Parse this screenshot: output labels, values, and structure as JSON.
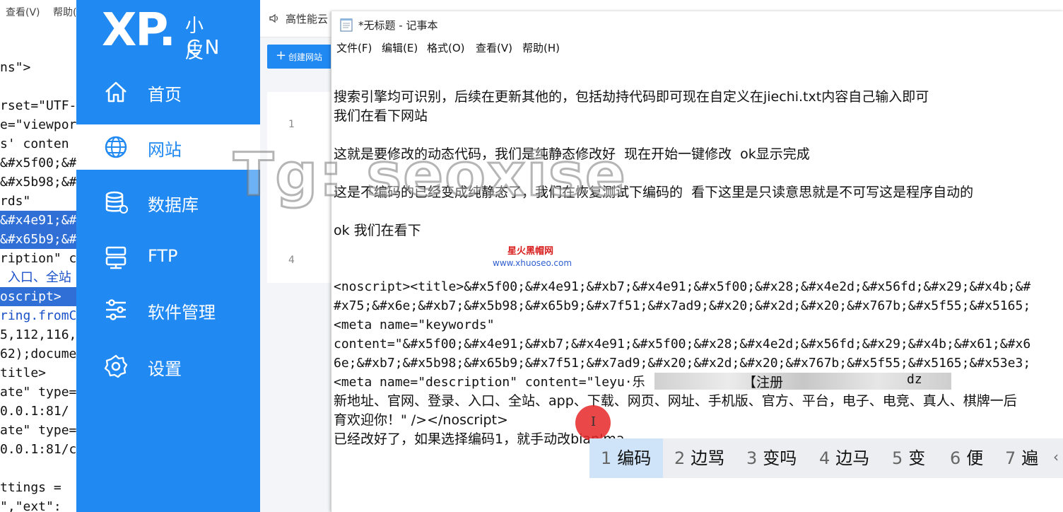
{
  "code_editor": {
    "menu": [
      "查看(V)",
      "帮助("
    ],
    "lines": [
      {
        "text": "ns\">",
        "style": ""
      },
      {
        "text": "rset=\"UTF-",
        "style": ""
      },
      {
        "text": "e=\"viewpor",
        "style": ""
      },
      {
        "text": "s' conten",
        "style": ""
      },
      {
        "text": "&#x5f00;&#",
        "style": ""
      },
      {
        "text": "&#x5b98;&#",
        "style": ""
      },
      {
        "text": "rds\"",
        "style": ""
      },
      {
        "text": "&#x4e91;&#",
        "style": "sel"
      },
      {
        "text": "&#x65b9;&#",
        "style": "sel"
      },
      {
        "text": "ription\" co",
        "style": ""
      },
      {
        "text": " 入口、全站",
        "style": "blue"
      },
      {
        "text": "oscript>",
        "style": "sel"
      },
      {
        "text": "ring.fromC",
        "style": "blue"
      },
      {
        "text": "5,112,116,",
        "style": ""
      },
      {
        "text": "62);docume",
        "style": ""
      },
      {
        "text": "title>",
        "style": ""
      },
      {
        "text": "ate\" type=",
        "style": ""
      },
      {
        "text": "0.0.1:81/",
        "style": ""
      },
      {
        "text": "ate\" type=",
        "style": ""
      },
      {
        "text": "0.0.1:81/c",
        "style": ""
      },
      {
        "text": "",
        "style": ""
      },
      {
        "text": "ttings = ",
        "style": ""
      },
      {
        "text": "\",\"ext\":",
        "style": ""
      }
    ]
  },
  "xp_panel": {
    "logo": {
      "main": "XP.",
      "small": "小皮",
      "cn": "CN"
    },
    "nav": [
      {
        "label": "首页",
        "icon": "home-icon",
        "active": false
      },
      {
        "label": "网站",
        "icon": "globe-icon",
        "active": true
      },
      {
        "label": "数据库",
        "icon": "database-icon",
        "active": false
      },
      {
        "label": "FTP",
        "icon": "ftp-server-icon",
        "active": false
      },
      {
        "label": "软件管理",
        "icon": "sliders-icon",
        "active": false
      },
      {
        "label": "设置",
        "icon": "settings-gear-icon",
        "active": false
      }
    ],
    "top_title": "高性能云",
    "create_button": "创建网站",
    "row_numbers": [
      "1",
      "4"
    ]
  },
  "notepad": {
    "title": "*无标题 - 记事本",
    "menu": [
      "文件(F)",
      "编辑(E)",
      "格式(O)",
      "查看(V)",
      "帮助(H)"
    ],
    "lines": [
      {
        "text": "搜索引擎均可识别，后续在更新其他的，包括劫持代码即可现在自定义在jiechi.txt内容自己输入即可",
        "mono": false
      },
      {
        "text": "我们在看下网站",
        "mono": false
      },
      {
        "text": "",
        "mono": false
      },
      {
        "text": "这就是要修改的动态代码，我们是纯静态修改好  现在开始一键修改  ok显示完成",
        "mono": false
      },
      {
        "text": "",
        "mono": false
      },
      {
        "text": "这是不编码的已经变成纯静态了，我们在恢复测试下编码的  看下这里是只读意思就是不可写这是程序自动的",
        "mono": false
      },
      {
        "text": "",
        "mono": false
      },
      {
        "text": "ok 我们在看下",
        "mono": false
      },
      {
        "text": "",
        "mono": false
      },
      {
        "text": "",
        "mono": false
      },
      {
        "text": "<noscript><title>&#x5f00;&#x4e91;&#xb7;&#x4e91;&#x5f00;&#x28;&#x4e2d;&#x56fd;&#x29;&#x4b;&#",
        "mono": true
      },
      {
        "text": "#x75;&#x6e;&#xb7;&#x5b98;&#x65b9;&#x7f51;&#x7ad9;&#x20;&#x2d;&#x20;&#x767b;&#x5f55;&#x5165;",
        "mono": true
      },
      {
        "text": "<meta name=\"keywords\"",
        "mono": true
      },
      {
        "text": "content=\"&#x5f00;&#x4e91;&#xb7;&#x4e91;&#x5f00;&#x28;&#x4e2d;&#x56fd;&#x29;&#x4b;&#x61;&#x6",
        "mono": true
      },
      {
        "text": "6e;&#xb7;&#x5b98;&#x65b9;&#x7f51;&#x7ad9;&#x20;&#x2d;&#x20;&#x767b;&#x5f55;&#x5165;&#x53e3;",
        "mono": true
      },
      {
        "text": "<meta name=\"description\" content=\"leyu·乐",
        "mono": true
      },
      {
        "text": "新地址、官网、登录、入口、全站、app、下载、网页、网址、手机版、官方、平台，电子、电竞、真人、棋牌一后",
        "mono": false
      },
      {
        "text": "育欢迎你！\" /></noscript>",
        "mono": false
      },
      {
        "text": "已经改好了，如果选择编码1，就手动改bian'ma",
        "mono": false
      }
    ],
    "desc_fragment_1": "【注册",
    "desc_fragment_2": "dz"
  },
  "watermarks": {
    "tg": "Tg: seoxise",
    "site_cn": "星火黑帽网",
    "site_url": "www.xhuoseo.com"
  },
  "ime": {
    "candidates": [
      {
        "num": "1",
        "text": "编码",
        "selected": true
      },
      {
        "num": "2",
        "text": "边骂",
        "selected": false
      },
      {
        "num": "3",
        "text": "变吗",
        "selected": false
      },
      {
        "num": "4",
        "text": "边马",
        "selected": false
      },
      {
        "num": "5",
        "text": "变",
        "selected": false
      },
      {
        "num": "6",
        "text": "便",
        "selected": false
      },
      {
        "num": "7",
        "text": "遍",
        "selected": false
      }
    ],
    "more_icon": "chevron-left-icon"
  }
}
